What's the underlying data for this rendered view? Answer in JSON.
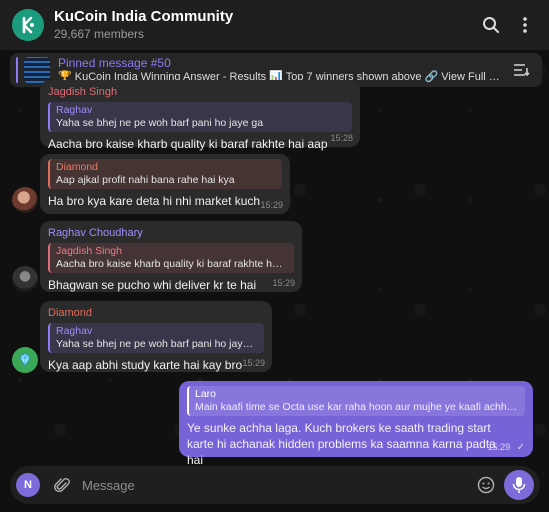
{
  "header": {
    "title": "KuCoin India Community",
    "members": "29,667 members",
    "scrolled_name": "Diamond"
  },
  "pinned": {
    "title": "Pinned message #50",
    "text": "🏆 KuCoin India Winning Answer - Results 📊 Top 7 winners shown above 🔗 View Full Leaderb..."
  },
  "messages": [
    {
      "sender": "Jagdish Singh",
      "reply_name": "Raghav",
      "reply_text": "Yaha se bhej ne pe woh barf pani ho jaye ga",
      "text": "Aacha bro kaise kharb quality ki baraf rakhte hai aap",
      "time": "15:28"
    },
    {
      "reply_name": "Diamond",
      "reply_text": "Aap ajkal profit nahi bana rahe hai kya",
      "text": "Ha bro kya kare deta hi nhi market kuch",
      "time": "15:29"
    },
    {
      "sender": "Raghav Choudhary",
      "reply_name": "Jagdish Singh",
      "reply_text": "Aacha bro kaise kharb quality ki baraf rakhte hai aap",
      "text": "Bhagwan se pucho whi deliver kr te hai",
      "time": "15:29"
    },
    {
      "sender": "Diamond",
      "reply_name": "Raghav",
      "reply_text": "Yaha se bhej ne pe woh barf pani ho jaye ga",
      "text": "Kya aap abhi study karte hai kay bro",
      "time": "15:29"
    },
    {
      "reply_name": "Laro",
      "reply_text": "Main kaafi time se Octa use kar raha hoon aur mujhe ye kaafi achha la...",
      "text": "Ye sunke achha laga. Kuch brokers ke saath trading start karte hi achanak hidden problems ka saamna karna padta hai",
      "time": "15:29",
      "status": "✓"
    }
  ],
  "input": {
    "placeholder": "Message",
    "avatar_initial": "N"
  },
  "colors": {
    "accent": "#7b6cd9",
    "raghav": "#8b7cf6",
    "jagdish": "#e06c75",
    "diamond": "#e06c5c"
  }
}
